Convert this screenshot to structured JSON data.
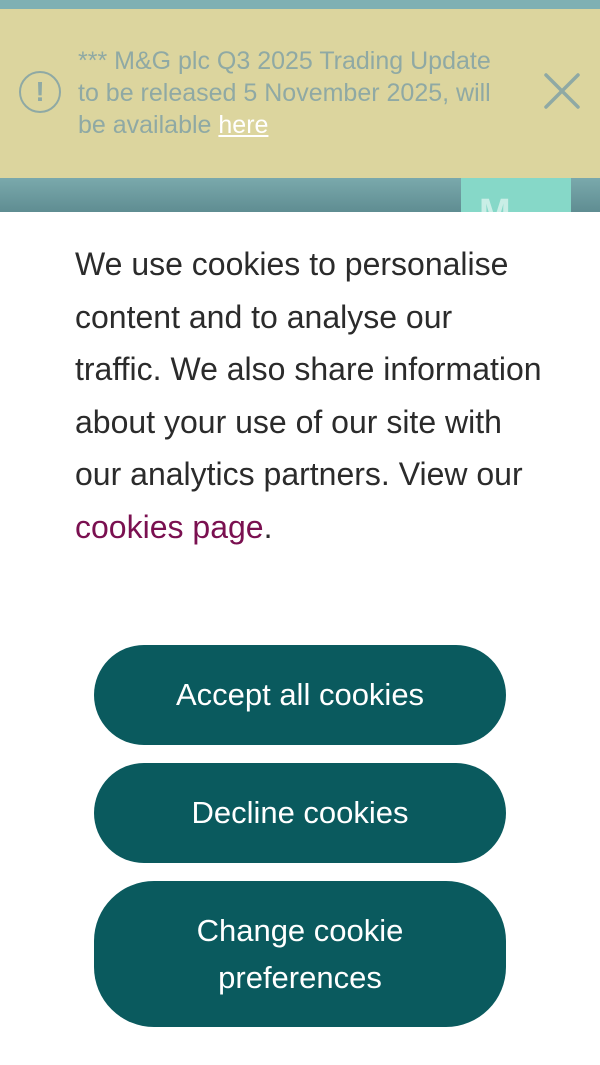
{
  "alert": {
    "message": "*** M&G plc Q3 2025 Trading Update to be released 5 November 2025, will be available ",
    "link_label": "here",
    "icon": "alert-circle-icon",
    "close_icon": "close-icon"
  },
  "header": {
    "logo_text": "M"
  },
  "cookie_banner": {
    "text": "We use cookies to personalise content and to analyse our traffic. We also share information about your use of our site with our analytics partners. View our ",
    "link_label": "cookies page",
    "text_end": ".",
    "accept_label": "Accept all cookies",
    "decline_label": "Decline cookies",
    "change_label": "Change cookie preferences"
  },
  "colors": {
    "alert_bg": "#dcd59e",
    "button_bg": "#0a5a5e",
    "link": "#7a1050"
  }
}
